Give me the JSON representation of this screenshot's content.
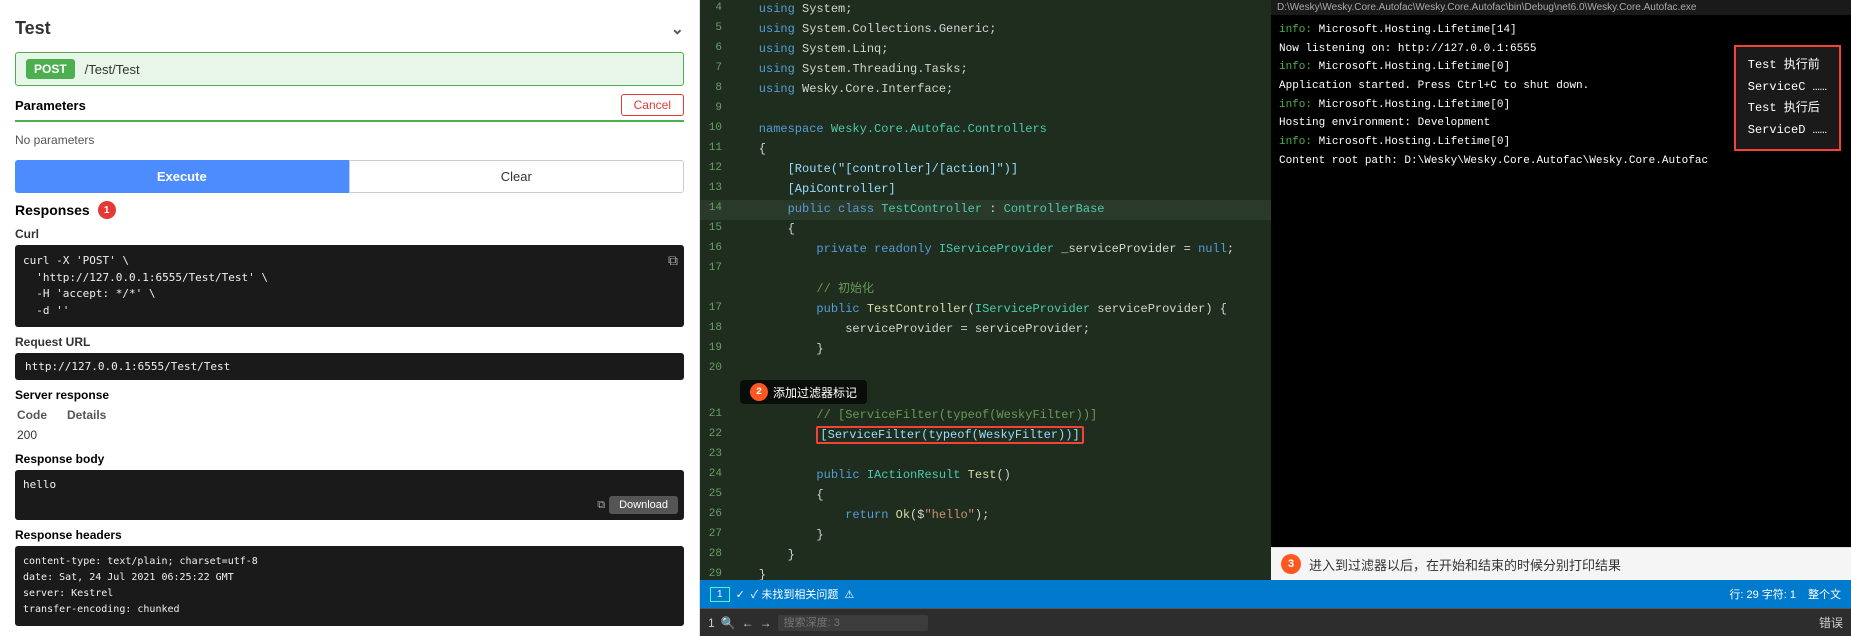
{
  "left": {
    "title": "Test",
    "method": "POST",
    "path": "/Test/Test",
    "params_title": "Parameters",
    "cancel_label": "Cancel",
    "no_params": "No parameters",
    "execute_label": "Execute",
    "clear_label": "Clear",
    "responses_title": "Responses",
    "badge_num": "1",
    "curl_label": "Curl",
    "curl_code": "curl -X 'POST' \\\n  'http://127.0.0.1:6555/Test/Test' \\\n  -H 'accept: */*' \\\n  -d ''",
    "request_url_label": "Request URL",
    "request_url": "http://127.0.0.1:6555/Test/Test",
    "server_response_label": "Server response",
    "code_header": "Code",
    "details_header": "Details",
    "code_200": "200",
    "response_body_label": "Response body",
    "response_body_content": "hello",
    "download_label": "Download",
    "response_headers_label": "Response headers",
    "response_headers_content": "content-type: text/plain; charset=utf-8\ndate: Sat, 24 Jul 2021 06:25:22 GMT\nserver: Kestrel\ntransfer-encoding: chunked"
  },
  "code_editor": {
    "lines": [
      {
        "num": "4",
        "text": "    using System;",
        "style": "kw-blue"
      },
      {
        "num": "5",
        "text": "    using System.Collections.Generic;"
      },
      {
        "num": "6",
        "text": "    using System.Linq;"
      },
      {
        "num": "7",
        "text": "    using System.Threading.Tasks;"
      },
      {
        "num": "8",
        "text": "    using Wesky.Core.Interface;"
      },
      {
        "num": "9",
        "text": ""
      },
      {
        "num": "10",
        "text": "    namespace Wesky.Core.Autofac.Controllers",
        "style": "kw-blue"
      },
      {
        "num": "11",
        "text": "    {"
      },
      {
        "num": "12",
        "text": "        [Route(\"[controller]/[action]\")]",
        "style": "kw-attr"
      },
      {
        "num": "13",
        "text": "        [ApiController]",
        "style": "kw-attr"
      },
      {
        "num": "14",
        "text": "        public class TestController : ControllerBase",
        "style": "kw-green"
      },
      {
        "num": "15",
        "text": "        {"
      },
      {
        "num": "16",
        "text": "            private readonly IServiceProvider _serviceProvider = null;"
      },
      {
        "num": "17",
        "text": ""
      },
      {
        "num": "17b",
        "text": "            // 初始化"
      },
      {
        "num": "17",
        "text": "            public TestController(IServiceProvider serviceProvider) {"
      },
      {
        "num": "18",
        "text": "                serviceProvider = serviceProvider;"
      },
      {
        "num": "19",
        "text": "            }"
      },
      {
        "num": "20",
        "text": ""
      },
      {
        "num": "21",
        "text": "            // [ServiceFilter(typeof(WeskyFilter))]"
      },
      {
        "num": "22",
        "text": "            [ServiceFilter(typeof(WeskyFilter))]",
        "highlight": true
      },
      {
        "num": "23",
        "text": ""
      },
      {
        "num": "24",
        "text": "            public IActionResult Test()"
      },
      {
        "num": "25",
        "text": "            {"
      },
      {
        "num": "26",
        "text": "                return Ok($\"hello\");"
      },
      {
        "num": "27",
        "text": "            }"
      },
      {
        "num": "28",
        "text": "        }"
      },
      {
        "num": "29",
        "text": "    }"
      }
    ]
  },
  "terminal": {
    "title": "D:\\Wesky\\Wesky.Core.Autofac\\Wesky.Core.Autofac\\bin\\Debug\\net6.0\\Wesky.Core.Autofac.exe",
    "logs": [
      {
        "type": "info",
        "text": "info: Microsoft.Hosting.Lifetime[14]"
      },
      {
        "type": "white",
        "text": "      Now listening on: http://127.0.0.1:6555"
      },
      {
        "type": "info",
        "text": "info: Microsoft.Hosting.Lifetime[0]"
      },
      {
        "type": "white",
        "text": "      Application started. Press Ctrl+C to shut down."
      },
      {
        "type": "info",
        "text": "info: Microsoft.Hosting.Lifetime[0]"
      },
      {
        "type": "white",
        "text": "      Hosting environment: Development"
      },
      {
        "type": "info",
        "text": "info: Microsoft.Hosting.Lifetime[0]"
      },
      {
        "type": "white",
        "text": "      Content root path: D:\\Wesky\\Wesky.Core.Autofac\\Wesky.Core.Autofac"
      }
    ],
    "result_box": {
      "lines": [
        "Test 执行前",
        "ServiceC ……",
        "Test 执行后",
        "ServiceD ……"
      ]
    }
  },
  "annotations": {
    "bubble2": "添加过滤器标记",
    "circle3": "3",
    "text3": "进入到过滤器以后，在开始和结束的时候分别打印结果"
  },
  "status_bar": {
    "tab_num": "1",
    "no_issues": "✓ 未找到相关问题",
    "line_info": "行: 29  字符: 1",
    "encoding": "整个文",
    "search_placeholder": "搜索深度: 3",
    "error_label": "错误"
  }
}
